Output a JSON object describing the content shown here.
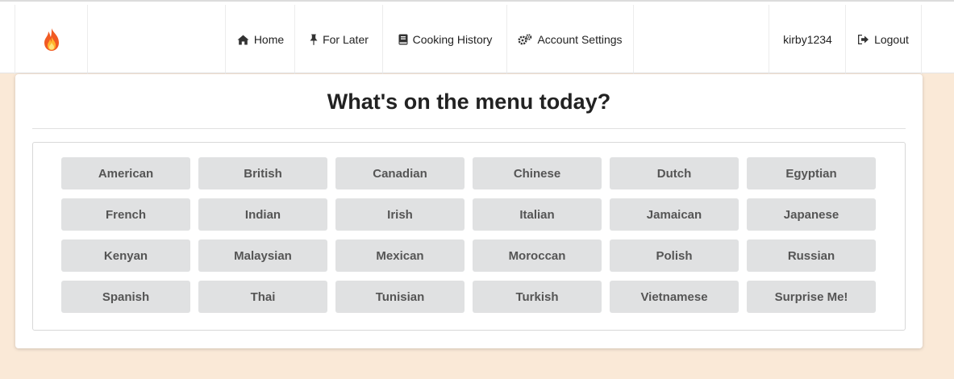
{
  "nav": {
    "logo_icon": "flame-icon",
    "home": "Home",
    "for_later": "For Later",
    "cooking_history": "Cooking History",
    "account_settings": "Account Settings",
    "username": "kirby1234",
    "logout": "Logout"
  },
  "main": {
    "title": "What's on the menu today?",
    "cuisines": [
      "American",
      "British",
      "Canadian",
      "Chinese",
      "Dutch",
      "Egyptian",
      "French",
      "Indian",
      "Irish",
      "Italian",
      "Jamaican",
      "Japanese",
      "Kenyan",
      "Malaysian",
      "Mexican",
      "Moroccan",
      "Polish",
      "Russian",
      "Spanish",
      "Thai",
      "Tunisian",
      "Turkish",
      "Vietnamese",
      "Surprise Me!"
    ]
  },
  "colors": {
    "page_background": "#fae9d7",
    "button_background": "#e0e1e2",
    "button_text": "#555555"
  }
}
